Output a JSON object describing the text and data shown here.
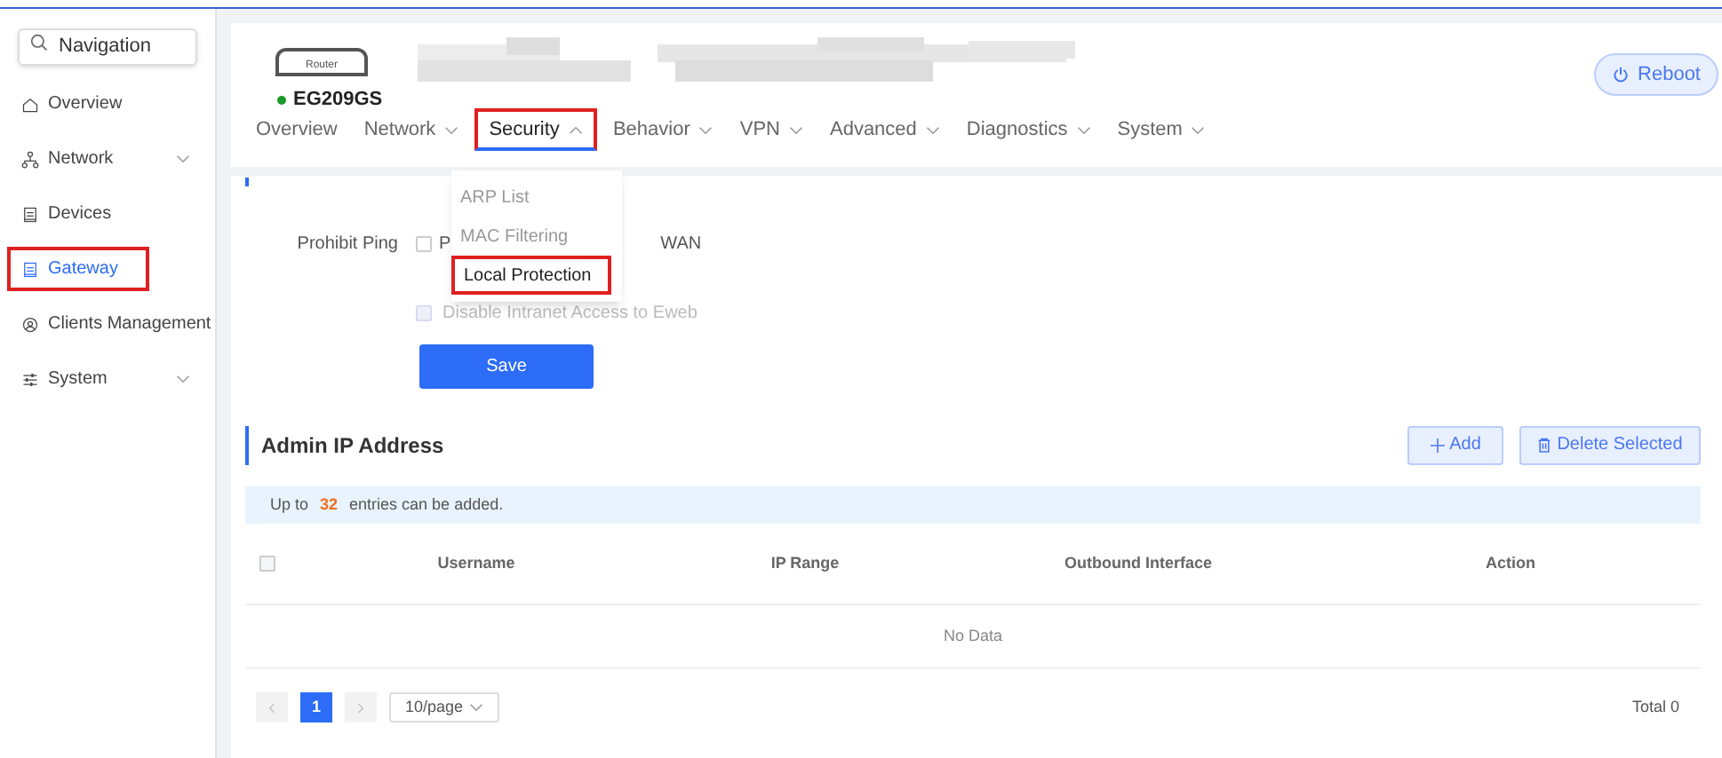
{
  "sidebar": {
    "search": {
      "placeholder": "Navigation"
    },
    "items": [
      {
        "label": "Overview",
        "expandable": false,
        "selected": false,
        "highlighted": false
      },
      {
        "label": "Network",
        "expandable": true,
        "selected": false,
        "highlighted": false
      },
      {
        "label": "Devices",
        "expandable": false,
        "selected": false,
        "highlighted": false
      },
      {
        "label": "Gateway",
        "expandable": false,
        "selected": true,
        "highlighted": true
      },
      {
        "label": "Clients Management",
        "expandable": false,
        "selected": false,
        "highlighted": false
      },
      {
        "label": "System",
        "expandable": true,
        "selected": false,
        "highlighted": false
      }
    ]
  },
  "header": {
    "device_label": "Router",
    "device_name": "EG209GS",
    "online": true,
    "redacted": true,
    "reboot": "Reboot",
    "tabs": [
      {
        "label": "Overview",
        "dropdown": false,
        "selected": false,
        "highlighted": false
      },
      {
        "label": "Network",
        "dropdown": true,
        "selected": false,
        "highlighted": false
      },
      {
        "label": "Security",
        "dropdown": true,
        "selected": true,
        "highlighted": true
      },
      {
        "label": "Behavior",
        "dropdown": true,
        "selected": false,
        "highlighted": false
      },
      {
        "label": "VPN",
        "dropdown": true,
        "selected": false,
        "highlighted": false
      },
      {
        "label": "Advanced",
        "dropdown": true,
        "selected": false,
        "highlighted": false
      },
      {
        "label": "Diagnostics",
        "dropdown": true,
        "selected": false,
        "highlighted": false
      },
      {
        "label": "System",
        "dropdown": true,
        "selected": false,
        "highlighted": false
      }
    ]
  },
  "dropdown_menu": [
    {
      "label": "ARP List",
      "selected": false,
      "highlighted": false
    },
    {
      "label": "MAC Filtering",
      "selected": false,
      "highlighted": false
    },
    {
      "label": "Local Protection",
      "selected": true,
      "highlighted": true
    }
  ],
  "form": {
    "prohibit_ping": {
      "label": "Prohibit Ping",
      "option_start": "P",
      "option_end": "WAN",
      "checked": false,
      "disabled": false
    },
    "intranet": {
      "label": "Disable Intranet Access to Eweb",
      "checked": false,
      "disabled": true
    },
    "save": "Save"
  },
  "admin_ip": {
    "title": "Admin IP Address",
    "add": "Add",
    "delete": "Delete Selected",
    "notice": "Up to **32** entries can be added.",
    "select_all": {
      "checked": false
    },
    "columns": [
      "Username",
      "IP Range",
      "Outbound Interface",
      "Action"
    ],
    "empty": "No Data",
    "page": "1",
    "page_size": "10/page",
    "total": "Total 0"
  }
}
